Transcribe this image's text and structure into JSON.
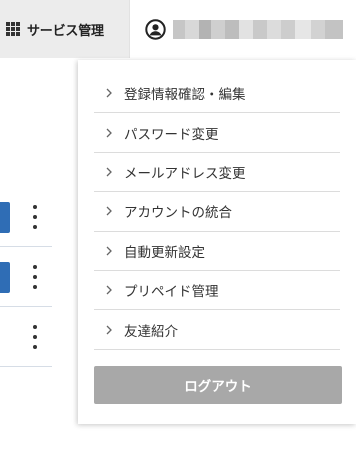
{
  "header": {
    "service_label": "サービス管理",
    "service_icon": "grid-icon",
    "user_icon": "user-circle-icon"
  },
  "menu": {
    "items": [
      {
        "label": "登録情報確認・編集"
      },
      {
        "label": "パスワード変更"
      },
      {
        "label": "メールアドレス変更"
      },
      {
        "label": "アカウントの統合"
      },
      {
        "label": "自動更新設定"
      },
      {
        "label": "プリペイド管理"
      },
      {
        "label": "友達紹介"
      }
    ],
    "item_icon": "chevron-right-icon",
    "logout_label": "ログアウト"
  },
  "colors": {
    "header_bg": "#ececec",
    "row_button": "#2f6db5",
    "logout_bg": "#a8a8a8"
  }
}
